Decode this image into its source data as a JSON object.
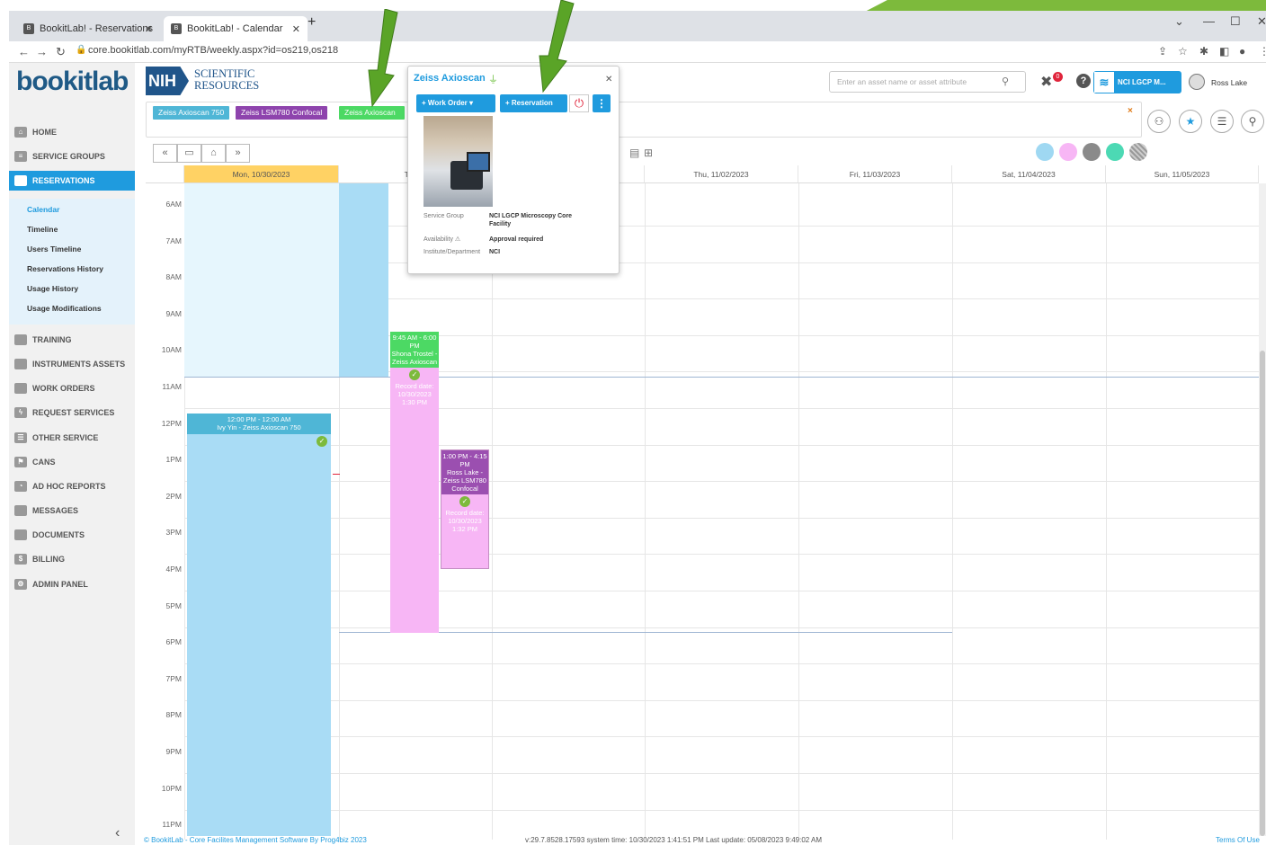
{
  "browser": {
    "tabs": [
      {
        "label": "BookitLab! - Reservations",
        "active": false
      },
      {
        "label": "BookitLab! - Calendar",
        "active": true
      }
    ],
    "url": "core.bookitlab.com/myRTB/weekly.aspx?id=os219,os218"
  },
  "header": {
    "logo": "bookitlab",
    "nih": "NIH",
    "scientific_resources_line1": "SCIENTIFIC",
    "scientific_resources_line2": "RESOURCES",
    "search_placeholder": "Enter an asset name or asset attribute",
    "notification_count": "0",
    "facility": "NCI LGCP M...",
    "user": "Ross Lake"
  },
  "sidebar": {
    "items": [
      {
        "label": "HOME"
      },
      {
        "label": "SERVICE GROUPS"
      },
      {
        "label": "RESERVATIONS"
      },
      {
        "label": "TRAINING"
      },
      {
        "label": "INSTRUMENTS ASSETS"
      },
      {
        "label": "WORK ORDERS"
      },
      {
        "label": "REQUEST SERVICES"
      },
      {
        "label": "OTHER SERVICE"
      },
      {
        "label": "CANS"
      },
      {
        "label": "AD HOC REPORTS"
      },
      {
        "label": "MESSAGES"
      },
      {
        "label": "DOCUMENTS"
      },
      {
        "label": "BILLING"
      },
      {
        "label": "ADMIN PANEL"
      }
    ],
    "subitems": [
      "Calendar",
      "Timeline",
      "Users Timeline",
      "Reservations History",
      "Usage History",
      "Usage Modifications"
    ]
  },
  "chips": [
    "Zeiss Axioscan 750",
    "Zeiss LSM780 Confocal",
    "Zeiss Axioscan"
  ],
  "calendar": {
    "days": [
      "Mon, 10/30/2023",
      "Tue, 1",
      "Thu, 11/02/2023",
      "Fri, 11/03/2023",
      "Sat, 11/04/2023",
      "Sun, 11/05/2023"
    ],
    "hours": [
      "6AM",
      "7AM",
      "8AM",
      "9AM",
      "10AM",
      "11AM",
      "12PM",
      "1PM",
      "2PM",
      "3PM",
      "4PM",
      "5PM",
      "6PM",
      "7PM",
      "8PM",
      "9PM",
      "10PM",
      "11PM"
    ],
    "events": {
      "ivy_line1": "12:00 PM - 12:00 AM",
      "ivy_line2": "Ivy Yin - Zeiss Axioscan 750",
      "shona_time": "9:45 AM - 6:00 PM",
      "shona_who": "Shona Trostel - Zeiss Axioscan",
      "shona_record": "Record date: 10/30/2023 1:30 PM",
      "ross_time": "1:00 PM - 4:15 PM",
      "ross_who": "Ross Lake - Zeiss LSM780 Confocal",
      "ross_record": "Record date: 10/30/2023 1:32 PM"
    }
  },
  "popover": {
    "title": "Zeiss Axioscan",
    "work_order": "Work Order",
    "reservation": "Reservation",
    "service_group_label": "Service Group",
    "service_group_value": "NCI LGCP Microscopy Core Facility",
    "availability_label": "Availability",
    "availability_value": "Approval required",
    "institute_label": "Institute/Department",
    "institute_value": "NCI"
  },
  "footer": {
    "left": "© BookitLab - Core Facilites Management Software By Prog4biz 2023",
    "mid": "v:29.7.8528.17593  system time: 10/30/2023 1:41:51 PM Last update: 05/08/2023 9:49:02 AM",
    "right": "Terms Of Use"
  },
  "colors": {
    "accent": "#1f9bde",
    "green": "#4cd964",
    "purple": "#8e44ad",
    "pink": "#f7b6f5",
    "cyan": "#4fb6d6"
  }
}
